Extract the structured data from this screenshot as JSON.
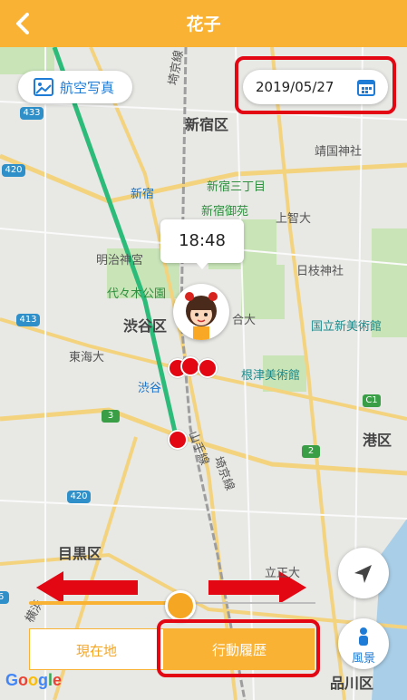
{
  "header": {
    "title": "花子"
  },
  "toolbar": {
    "aerial_label": "航空写真",
    "date": "2019/05/27"
  },
  "timeline": {
    "time": "18:48"
  },
  "map_labels": {
    "shinjuku_ku": "新宿区",
    "shibuya_ku": "渋谷区",
    "minato_ku": "港区",
    "meguro_ku": "目黒区",
    "shinagawa_ku": "品川区",
    "shinjuku_sanchome": "新宿三丁目",
    "shinjuku": "新宿",
    "shinjuku_gyoen": "新宿御苑",
    "meiji_jingu": "明治神宮",
    "yoyogi_koen": "代々木公園",
    "tokai_dai": "東海大",
    "shibuya": "渋谷",
    "yasukuni": "靖国神社",
    "jochi_dai": "上智大",
    "hie_jinja": "日枝神社",
    "kokuritsu": "国立新美術館",
    "nezu": "根津美術館",
    "yamanote": "山手線",
    "saikyo": "埼京線",
    "saikyo2": "埼京線",
    "gou_dai": "合大",
    "rikkyo": "立正大",
    "katakura": "横浜"
  },
  "road_shields": [
    "433",
    "420",
    "413",
    "420",
    "3",
    "2",
    "6",
    "C1"
  ],
  "slider": {
    "value": 0.52
  },
  "mode_tabs": {
    "current": "現在地",
    "history": "行動履歴",
    "selected": "history"
  },
  "scenery_label": "風景",
  "google_logo": "Google",
  "colors": {
    "header": "#f9b233",
    "accent": "#1e7bd6",
    "route": "#2dbb7a",
    "marker": "#e30613",
    "annotation": "#e30613"
  }
}
